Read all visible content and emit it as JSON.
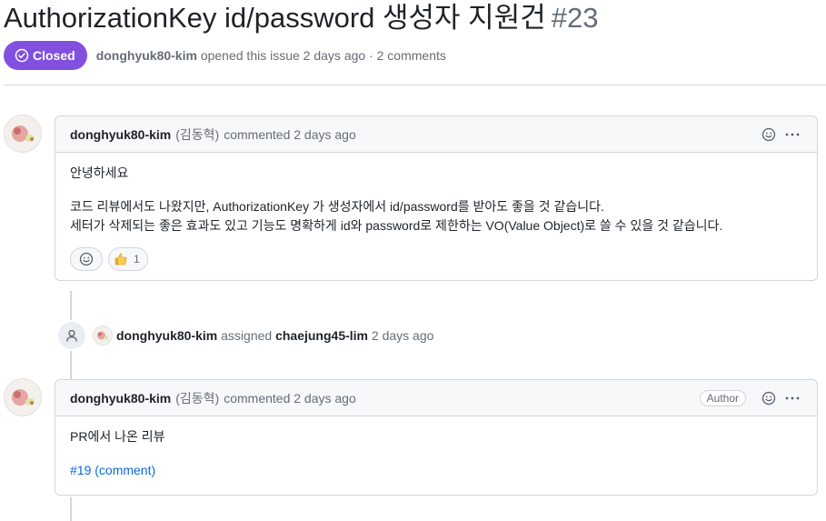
{
  "issue": {
    "title": "AuthorizationKey id/password 생성자 지원건",
    "number": "#23",
    "state": "Closed",
    "author": "donghyuk80-kim",
    "opened_text": "opened this issue 2 days ago · 2 comments"
  },
  "colors": {
    "closed": "#8250df",
    "link": "#0969da",
    "border": "#d0d7de"
  },
  "comments": [
    {
      "author": "donghyuk80-kim",
      "realname": "(김동혁)",
      "meta": "commented 2 days ago",
      "author_badge": "",
      "body": [
        "안녕하세요",
        "코드 리뷰에서도 나왔지만, AuthorizationKey 가 생성자에서 id/password를 받아도 좋을 것 같습니다.",
        "세터가 삭제되는 좋은 효과도 있고 기능도 명확하게 id와 password로 제한하는 VO(Value Object)로 쓸 수 있을 것 같습니다."
      ],
      "reaction_thumbs_count": "1"
    },
    {
      "author": "donghyuk80-kim",
      "realname": "(김동혁)",
      "meta": "commented 2 days ago",
      "author_badge": "Author",
      "body": [
        "PR에서 나온 리뷰"
      ],
      "link_text": "#19 (comment)"
    }
  ],
  "event": {
    "actor": "donghyuk80-kim",
    "action": "assigned",
    "target": "chaejung45-lim",
    "time": "2 days ago"
  }
}
